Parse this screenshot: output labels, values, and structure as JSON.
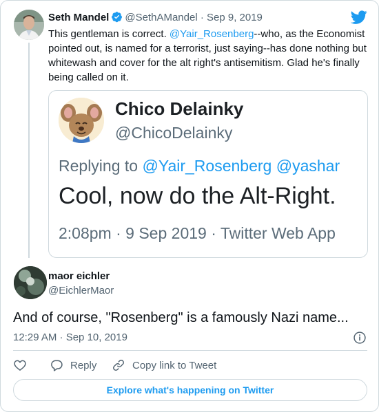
{
  "parent_tweet": {
    "author_name": "Seth Mandel",
    "author_handle": "@SethAMandel",
    "separator": "·",
    "date": "Sep 9, 2019",
    "verified": true,
    "text_before_mention": "This gentleman is correct. ",
    "mention": "@Yair_Rosenberg",
    "text_after_mention": "--who, as the Economist pointed out, is named for a terrorist, just saying--has done nothing but whitewash and cover for the alt right's antisemitism. Glad he's finally being called on it."
  },
  "embedded_screenshot": {
    "author_name": "Chico Delainky",
    "author_handle": "@ChicoDelainky",
    "replying_label": "Replying to",
    "reply_mention_1": "@Yair_Rosenberg",
    "reply_mention_2": "@yashar",
    "text": "Cool, now do the Alt-Right.",
    "meta": "2:08pm · 9 Sep 2019 · Twitter Web App"
  },
  "main_tweet": {
    "author_name": "maor eichler",
    "author_handle": "@EichlerMaor",
    "text": "And of course, \"Rosenberg\" is a famously Nazi name...",
    "timestamp": "12:29 AM · Sep 10, 2019"
  },
  "actions": {
    "reply_label": "Reply",
    "copy_link_label": "Copy link to Tweet"
  },
  "explore_button": "Explore what's happening on Twitter",
  "colors": {
    "accent": "#1d9bf0",
    "text": "#0f1419",
    "muted": "#536471",
    "border": "#cfd9de"
  },
  "icons": [
    "twitter-bird-icon",
    "verified-badge-icon",
    "info-icon",
    "heart-icon",
    "reply-bubble-icon",
    "link-icon"
  ]
}
